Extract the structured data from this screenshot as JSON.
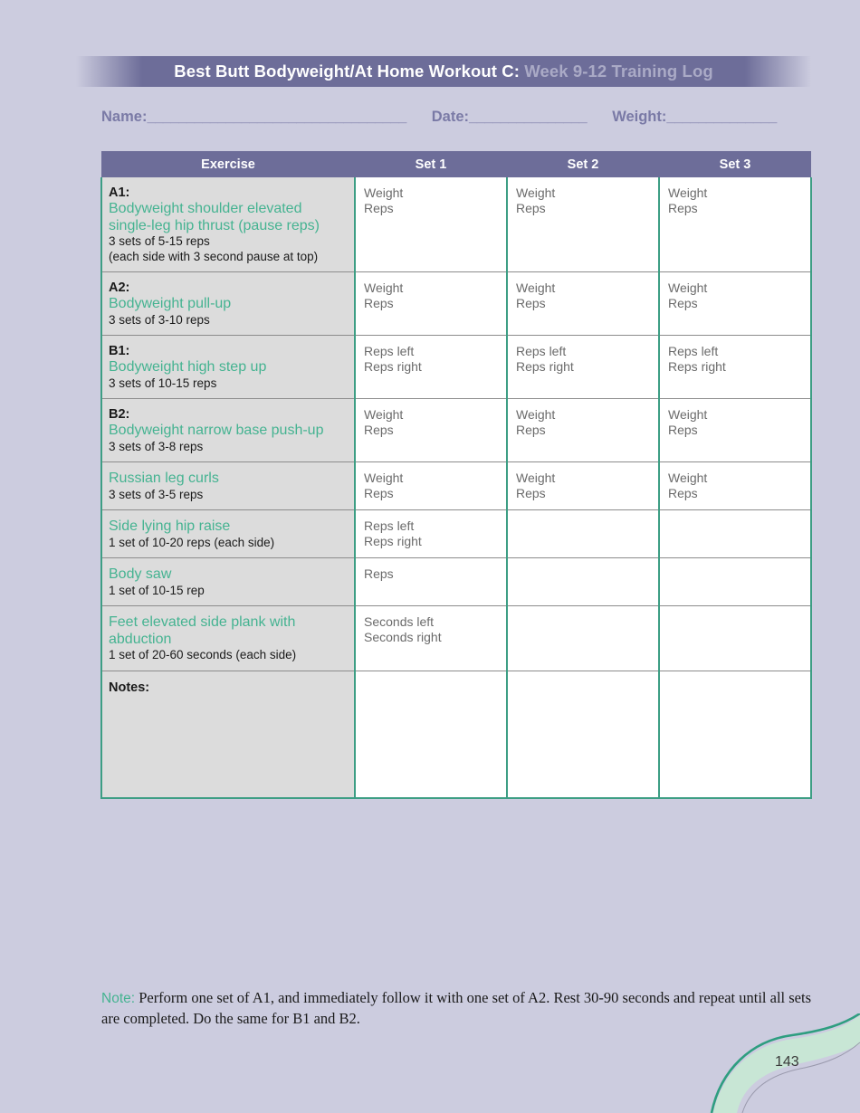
{
  "banner": {
    "strong": "Best Butt Bodyweight/At Home",
    "mid": " Workout C:",
    "light": " Week 9-12 Training Log"
  },
  "fields": {
    "name_label": "Name:",
    "name_blank": "_________________________________",
    "date_label": "Date:",
    "date_blank": "_______________",
    "weight_label": "Weight:",
    "weight_blank": "______________"
  },
  "table": {
    "headers": [
      "Exercise",
      "Set 1",
      "Set 2",
      "Set 3"
    ],
    "rows": [
      {
        "prefix": "A1:",
        "name": "Bodyweight shoulder elevated single-leg hip thrust (pause reps)",
        "detail1": "3 sets of 5-15 reps",
        "detail2": "(each side with 3 second pause at top)",
        "set1_top": "Weight",
        "set1_bottom": "Reps",
        "set2_top": "Weight",
        "set2_bottom": "Reps",
        "set3_top": "Weight",
        "set3_bottom": "Reps"
      },
      {
        "prefix": "A2:",
        "name": "Bodyweight pull-up",
        "detail1": "3 sets of 3-10 reps",
        "detail2": "",
        "set1_top": "Weight",
        "set1_bottom": "Reps",
        "set2_top": "Weight",
        "set2_bottom": "Reps",
        "set3_top": "Weight",
        "set3_bottom": "Reps"
      },
      {
        "prefix": "B1:",
        "name": "Bodyweight high step up",
        "detail1": "3 sets of 10-15 reps",
        "detail2": "",
        "set1_top": "Reps left",
        "set1_bottom": "Reps right",
        "set2_top": "Reps left",
        "set2_bottom": "Reps right",
        "set3_top": "Reps left",
        "set3_bottom": "Reps right"
      },
      {
        "prefix": "B2:",
        "name": "Bodyweight narrow base push-up",
        "detail1": "3 sets of 3-8 reps",
        "detail2": "",
        "set1_top": "Weight",
        "set1_bottom": "Reps",
        "set2_top": "Weight",
        "set2_bottom": "Reps",
        "set3_top": "Weight",
        "set3_bottom": "Reps"
      },
      {
        "prefix": "",
        "name": "Russian leg curls",
        "detail1": "3 sets of 3-5 reps",
        "detail2": "",
        "set1_top": "Weight",
        "set1_bottom": "Reps",
        "set2_top": "Weight",
        "set2_bottom": "Reps",
        "set3_top": "Weight",
        "set3_bottom": "Reps"
      },
      {
        "prefix": "",
        "name": "Side lying hip raise",
        "detail1": "1 set of 10-20 reps (each side)",
        "detail2": "",
        "set1_top": "Reps left",
        "set1_bottom": "Reps right",
        "set2_top": "",
        "set2_bottom": "",
        "set3_top": "",
        "set3_bottom": ""
      },
      {
        "prefix": "",
        "name": "Body saw",
        "detail1": "1 set of 10-15 rep",
        "detail2": "",
        "set1_top": "Reps",
        "set1_bottom": "",
        "set2_top": "",
        "set2_bottom": "",
        "set3_top": "",
        "set3_bottom": ""
      },
      {
        "prefix": "",
        "name": "Feet elevated side plank with abduction",
        "detail1": "1 set of 20-60 seconds (each side)",
        "detail2": "",
        "set1_top": "Seconds left",
        "set1_bottom": "Seconds right",
        "set2_top": "",
        "set2_bottom": "",
        "set3_top": "",
        "set3_bottom": ""
      }
    ],
    "notes_label": "Notes:"
  },
  "footnote": {
    "label": "Note:",
    "text": " Perform one set of A1, and immediately follow it with one set of A2. Rest 30-90 seconds and repeat until all sets are completed. Do the same for B1 and B2."
  },
  "page_number": "143",
  "colors": {
    "page_background": "#ccccdf",
    "banner": "#6d6d99",
    "banner_light_text": "#aaaac6",
    "accent_teal": "#45b391",
    "border_teal": "#3d9e84",
    "exercise_cell": "#dcdcdc",
    "field_label": "#7a7aa6",
    "set_label": "#6b6b6b",
    "deco_band": "#c8e6d5"
  }
}
